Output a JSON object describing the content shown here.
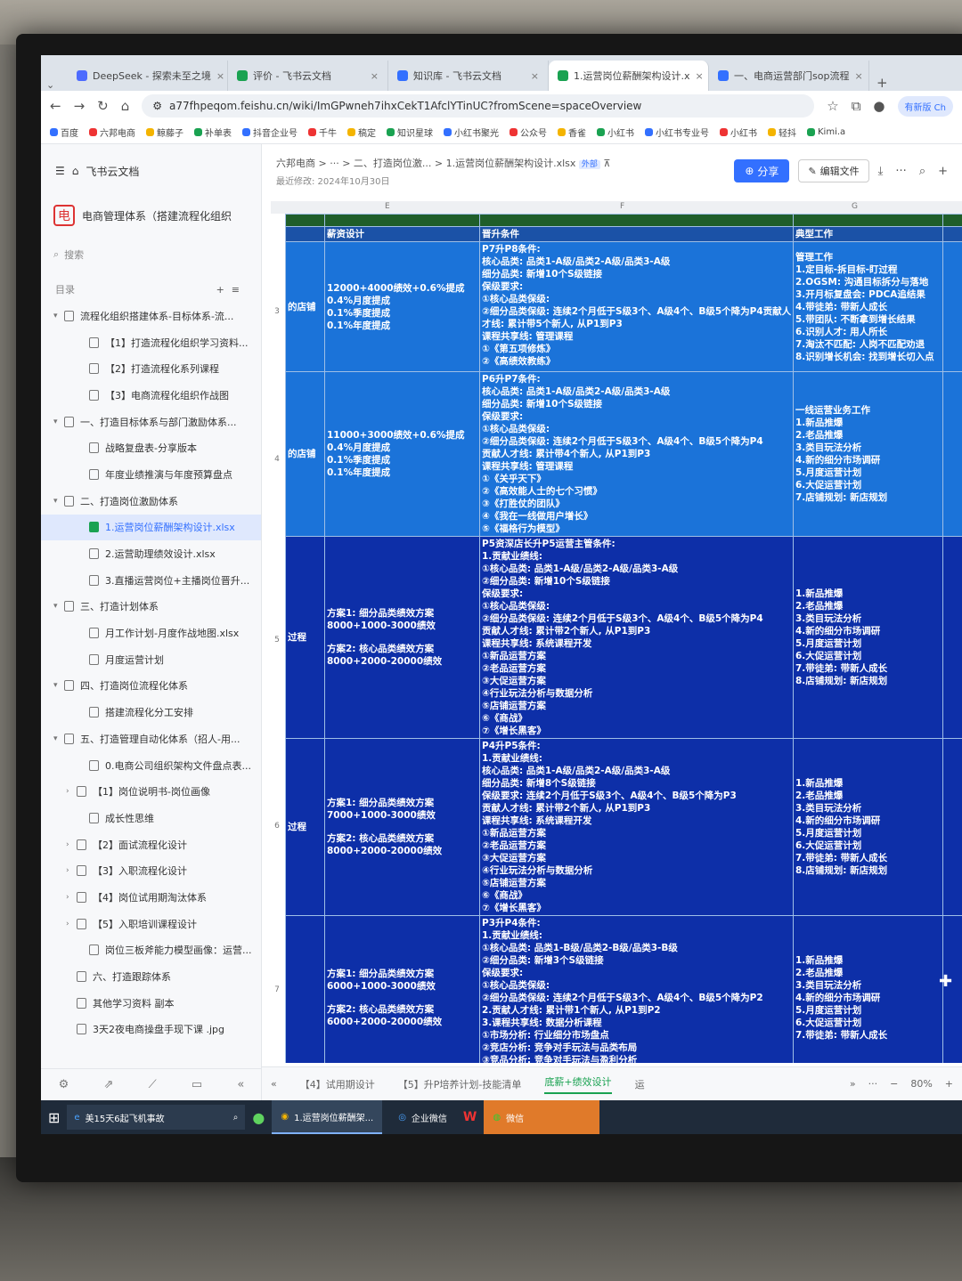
{
  "tabs": [
    {
      "label": "DeepSeek - 探索未至之境",
      "color": "#4d6bfe"
    },
    {
      "label": "评价 - 飞书云文档",
      "color": "#1aa251"
    },
    {
      "label": "知识库 - 飞书云文档",
      "color": "#3370ff"
    },
    {
      "label": "1.运营岗位薪酬架构设计.x",
      "color": "#1aa251"
    },
    {
      "label": "一、电商运营部门sop流程",
      "color": "#3370ff"
    }
  ],
  "url": "a77fhpeqom.feishu.cn/wiki/ImGPwneh7ihxCekT1AfclYTinUC?fromScene=spaceOverview",
  "update_button": "有新版 Ch",
  "bookmarks": [
    "百度",
    "六邦电商",
    "鲸藤子",
    "补单表",
    "抖音企业号",
    "千牛",
    "稿定",
    "知识星球",
    "小红书聚光",
    "公众号",
    "香雀",
    "小红书",
    "小红书专业号",
    "小红书",
    "轻抖",
    "Kimi.a"
  ],
  "sidebar": {
    "app": "飞书云文档",
    "space": "电商管理体系（搭建流程化组织",
    "space_logo": "电",
    "search": "搜索",
    "toc": "目录",
    "items": [
      {
        "label": "流程化组织搭建体系-目标体系-流...",
        "caret": "▾"
      },
      {
        "label": "【1】打造流程化组织学习资料...",
        "caret": ""
      },
      {
        "label": "【2】打造流程化系列课程",
        "caret": ""
      },
      {
        "label": "【3】电商流程化组织作战图",
        "caret": ""
      },
      {
        "label": "一、打造目标体系与部门激励体系...",
        "caret": "▾"
      },
      {
        "label": "战略复盘表-分享版本",
        "caret": ""
      },
      {
        "label": "年度业绩推演与年度预算盘点",
        "caret": ""
      },
      {
        "label": "二、打造岗位激励体系",
        "caret": "▾"
      },
      {
        "label": "1.运营岗位薪酬架构设计.xlsx",
        "caret": ""
      },
      {
        "label": "2.运营助理绩效设计.xlsx",
        "caret": ""
      },
      {
        "label": "3.直播运营岗位+主播岗位晋升...",
        "caret": ""
      },
      {
        "label": "三、打造计划体系",
        "caret": "▾"
      },
      {
        "label": "月工作计划-月度作战地图.xlsx",
        "caret": ""
      },
      {
        "label": "月度运营计划",
        "caret": ""
      },
      {
        "label": "四、打造岗位流程化体系",
        "caret": "▾"
      },
      {
        "label": "搭建流程化分工安排",
        "caret": ""
      },
      {
        "label": "五、打造管理自动化体系（招人-用...",
        "caret": "▾"
      },
      {
        "label": "0.电商公司组织架构文件盘点表...",
        "caret": ""
      },
      {
        "label": "【1】岗位说明书-岗位画像",
        "caret": "›"
      },
      {
        "label": "成长性思维",
        "caret": ""
      },
      {
        "label": "【2】面试流程化设计",
        "caret": "›"
      },
      {
        "label": "【3】入职流程化设计",
        "caret": "›"
      },
      {
        "label": "【4】岗位试用期淘汰体系",
        "caret": "›"
      },
      {
        "label": "【5】入职培训课程设计",
        "caret": "›"
      },
      {
        "label": "岗位三板斧能力模型画像：运营...",
        "caret": ""
      },
      {
        "label": "六、打造跟踪体系",
        "caret": ""
      },
      {
        "label": "其他学习资料 副本",
        "caret": ""
      },
      {
        "label": "3天2夜电商操盘手现下课 .jpg",
        "caret": ""
      }
    ]
  },
  "doc": {
    "breadcrumb": "六邦电商  >  ···  >  二、打造岗位激...  >  1.运营岗位薪酬架构设计.xlsx",
    "tag": "外部",
    "modified": "最近修改: 2024年10月30日",
    "share": "分享",
    "edit": "编辑文件"
  },
  "columns": {
    "e": "E",
    "f": "F",
    "g": "G"
  },
  "headers": {
    "salary": "薪资设计",
    "promotion": "晋升条件",
    "work": "典型工作"
  },
  "rows": [
    {
      "num": "3",
      "label": "的店铺",
      "salary": [
        "12000+4000绩效+0.6%提成",
        "0.4%月度提成",
        "0.1%季度提成",
        "0.1%年度提成"
      ],
      "promotion": [
        "P7升P8条件:",
        "核心品类: 品类1-A级/品类2-A级/品类3-A级",
        "细分品类: 新增10个S级链接",
        "保级要求:",
        "①核心品类保级:",
        "②细分品类保级: 连续2个月低于S级3个、A级4个、B级5个降为P4贡献人",
        "才线: 累计带5个新人, 从P1到P3",
        "课程共享线: 管理课程",
        "①《第五项修炼》",
        "②《高绩效教练》"
      ],
      "work": [
        "管理工作",
        "1.定目标-拆目标-盯过程",
        "2.OGSM: 沟通目标拆分与落地",
        "3.开月标复盘会: PDCA追结果",
        "4.带徒弟: 带新人成长",
        "5.带团队: 不断拿到增长结果",
        "6.识别人才: 用人所长",
        "7.淘汰不匹配: 人岗不匹配劝退",
        "8.识别增长机会: 找到增长切入点"
      ]
    },
    {
      "num": "4",
      "label": "的店铺",
      "salary": [
        "11000+3000绩效+0.6%提成",
        "0.4%月度提成",
        "0.1%季度提成",
        "0.1%年度提成"
      ],
      "promotion": [
        "P6升P7条件:",
        "核心品类: 品类1-A级/品类2-A级/品类3-A级",
        "细分品类: 新增10个S级链接",
        "保级要求:",
        "①核心品类保级:",
        "②细分品类保级: 连续2个月低于S级3个、A级4个、B级5个降为P4",
        "贡献人才线: 累计带4个新人, 从P1到P3",
        "课程共享线: 管理课程",
        "①《关乎天下》",
        "②《高效能人士的七个习惯》",
        "③《打胜仗的团队》",
        "④《我在一线做用户增长》",
        "⑤《福格行为模型》"
      ],
      "work": [
        "一线运营业务工作",
        "1.新品推爆",
        "2.老品推爆",
        "3.类目玩法分析",
        "4.新的细分市场调研",
        "5.月度运营计划",
        "6.大促运营计划",
        "7.店铺规划: 新店规划"
      ]
    },
    {
      "num": "5",
      "label": "过程",
      "salary": [
        "方案1: 细分品类绩效方案",
        "8000+1000-3000绩效",
        "",
        "方案2: 核心品类绩效方案",
        "8000+2000-20000绩效"
      ],
      "promotion": [
        "P5资深店长升P5运营主管条件:",
        "1.贡献业绩线:",
        "①核心品类: 品类1-A级/品类2-A级/品类3-A级",
        "②细分品类: 新增10个S级链接",
        "保级要求:",
        "①核心品类保级:",
        "②细分品类保级: 连续2个月低于S级3个、A级4个、B级5个降为P4",
        "贡献人才线: 累计带2个新人, 从P1到P3",
        "课程共享线: 系统课程开发",
        "①新品运营方案",
        "②老品运营方案",
        "③大促运营方案",
        "④行业玩法分析与数据分析",
        "⑤店铺运营方案",
        "⑥《商战》",
        "⑦《增长黑客》"
      ],
      "work": [
        "1.新品推爆",
        "2.老品推爆",
        "3.类目玩法分析",
        "4.新的细分市场调研",
        "5.月度运营计划",
        "6.大促运营计划",
        "7.带徒弟: 带新人成长",
        "8.店铺规划: 新店规划"
      ]
    },
    {
      "num": "6",
      "label": "过程",
      "salary": [
        "方案1: 细分品类绩效方案",
        "7000+1000-3000绩效",
        "",
        "方案2: 核心品类绩效方案",
        "8000+2000-20000绩效"
      ],
      "promotion": [
        "P4升P5条件:",
        "1.贡献业绩线:",
        "核心品类: 品类1-A级/品类2-A级/品类3-A级",
        "细分品类: 新增8个S级链接",
        "保级要求: 连续2个月低于S级3个、A级4个、B级5个降为P3",
        "贡献人才线: 累计带2个新人, 从P1到P3",
        "课程共享线: 系统课程开发",
        "①新品运营方案",
        "②老品运营方案",
        "③大促运营方案",
        "④行业玩法分析与数据分析",
        "⑤店铺运营方案",
        "⑥《商战》",
        "⑦《增长黑客》"
      ],
      "work": [
        "1.新品推爆",
        "2.老品推爆",
        "3.类目玩法分析",
        "4.新的细分市场调研",
        "5.月度运营计划",
        "6.大促运营计划",
        "7.带徒弟: 带新人成长",
        "8.店铺规划: 新店规划"
      ]
    },
    {
      "num": "7",
      "label": "",
      "salary": [
        "方案1: 细分品类绩效方案",
        "6000+1000-3000绩效",
        "",
        "方案2: 核心品类绩效方案",
        "6000+2000-20000绩效"
      ],
      "promotion": [
        "P3升P4条件:",
        "1.贡献业绩线:",
        "①核心品类: 品类1-B级/品类2-B级/品类3-B级",
        "②细分品类: 新增3个S级链接",
        "保级要求:",
        "①核心品类保级:",
        "②细分品类保级: 连续2个月低于S级3个、A级4个、B级5个降为P2",
        "2.贡献人才线: 累计带1个新人, 从P1到P2",
        "3.课程共享线: 数据分析课程",
        "①市场分析: 行业细分市场盘点",
        "②竞店分析: 竞争对手玩法与品类布局",
        "③竞品分析: 竞争对手玩法与盈利分析",
        "④单品诊断: 店铺单品诊断"
      ],
      "work": [
        "1.新品推爆",
        "2.老品推爆",
        "3.类目玩法分析",
        "4.新的细分市场调研",
        "5.月度运营计划",
        "6.大促运营计划",
        "7.带徒弟: 带新人成长"
      ]
    }
  ],
  "sheet_tabs": [
    "【4】试用期设计",
    "【5】升P培养计划-技能清单",
    "底薪+绩效设计",
    "运"
  ],
  "zoom": "80%",
  "taskbar": {
    "search": "美15天6起飞机事故",
    "chrome": "1.运营岗位薪酬架...",
    "wecom": "企业微信",
    "wechat": "微信"
  }
}
